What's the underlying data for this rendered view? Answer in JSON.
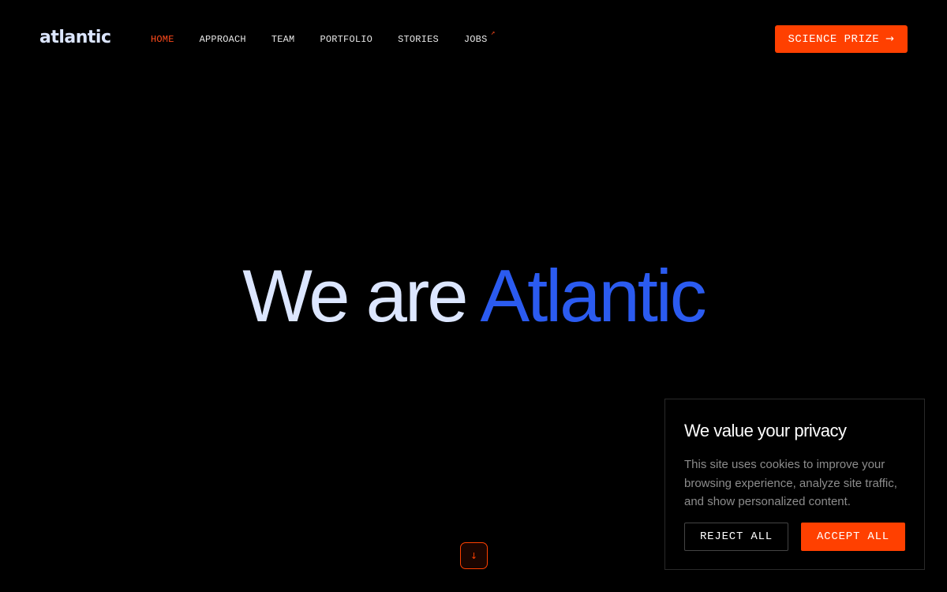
{
  "header": {
    "logo_text": "atlantic",
    "nav": [
      {
        "label": "HOME",
        "active": true
      },
      {
        "label": "APPROACH",
        "active": false
      },
      {
        "label": "TEAM",
        "active": false
      },
      {
        "label": "PORTFOLIO",
        "active": false
      },
      {
        "label": "STORIES",
        "active": false
      },
      {
        "label": "JOBS",
        "active": false,
        "external_icon": "arrow-up-right-icon"
      }
    ],
    "cta": {
      "label": "SCIENCE PRIZE",
      "icon": "arrow-right-icon",
      "arrow_glyph": "→"
    }
  },
  "hero": {
    "prefix": "We are",
    "highlight": "Atlantic"
  },
  "scroll_button": {
    "icon": "arrow-down-icon",
    "glyph": "↓"
  },
  "cookie_banner": {
    "title": "We value your privacy",
    "text": "This site uses cookies to improve your browsing experience, analyze site traffic, and show personalized content.",
    "reject_label": "REJECT ALL",
    "accept_label": "ACCEPT ALL"
  },
  "colors": {
    "background": "#000000",
    "accent": "#ff4000",
    "brand_blue": "#2b5bf0",
    "light_text": "#dce6ff"
  }
}
